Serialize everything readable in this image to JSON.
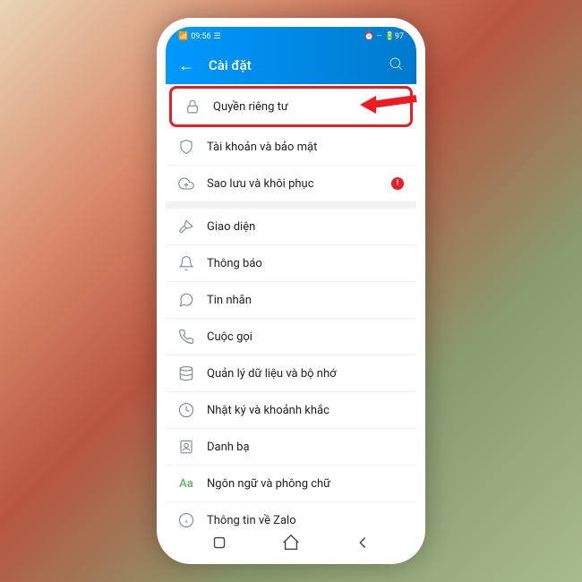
{
  "status": {
    "time": "09:56",
    "battery": "97"
  },
  "header": {
    "title": "Cài đặt"
  },
  "groups": [
    {
      "items": [
        {
          "icon": "lock",
          "label": "Quyền riêng tư",
          "highlighted": true
        },
        {
          "icon": "shield",
          "label": "Tài khoản và bảo mật"
        },
        {
          "icon": "cloud",
          "label": "Sao lưu và khôi phục",
          "alert": true
        }
      ]
    },
    {
      "items": [
        {
          "icon": "brush",
          "label": "Giao diện"
        },
        {
          "icon": "bell",
          "label": "Thông báo"
        },
        {
          "icon": "message",
          "label": "Tin nhắn"
        },
        {
          "icon": "phone",
          "label": "Cuộc gọi"
        },
        {
          "icon": "data",
          "label": "Quản lý dữ liệu và bộ nhớ"
        },
        {
          "icon": "clock",
          "label": "Nhật ký và khoảnh khắc"
        },
        {
          "icon": "contacts",
          "label": "Danh bạ"
        },
        {
          "icon": "aa",
          "label": "Ngôn ngữ và phông chữ"
        },
        {
          "icon": "info",
          "label": "Thông tin về Zalo"
        }
      ]
    }
  ]
}
